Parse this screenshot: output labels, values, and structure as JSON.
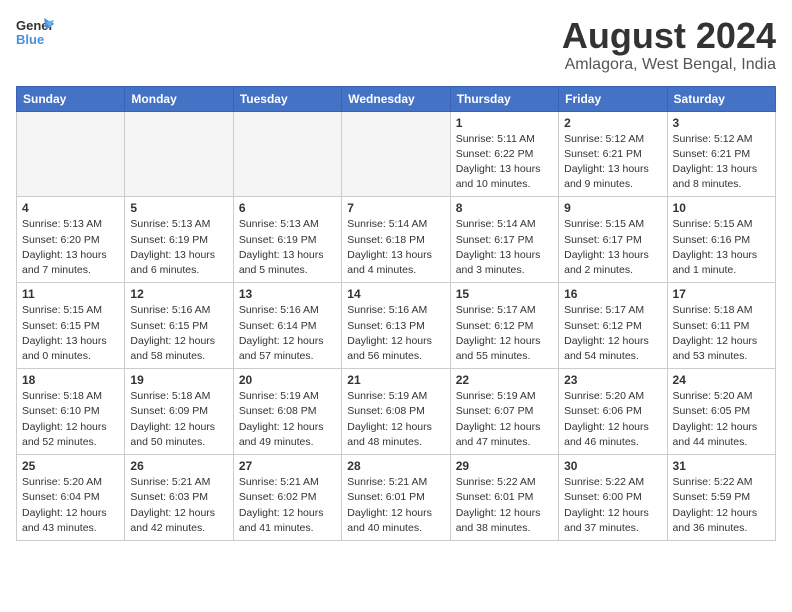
{
  "header": {
    "logo_general": "General",
    "logo_blue": "Blue",
    "month_year": "August 2024",
    "location": "Amlagora, West Bengal, India"
  },
  "days_of_week": [
    "Sunday",
    "Monday",
    "Tuesday",
    "Wednesday",
    "Thursday",
    "Friday",
    "Saturday"
  ],
  "weeks": [
    [
      {
        "day": "",
        "info": ""
      },
      {
        "day": "",
        "info": ""
      },
      {
        "day": "",
        "info": ""
      },
      {
        "day": "",
        "info": ""
      },
      {
        "day": "1",
        "info": "Sunrise: 5:11 AM\nSunset: 6:22 PM\nDaylight: 13 hours\nand 10 minutes."
      },
      {
        "day": "2",
        "info": "Sunrise: 5:12 AM\nSunset: 6:21 PM\nDaylight: 13 hours\nand 9 minutes."
      },
      {
        "day": "3",
        "info": "Sunrise: 5:12 AM\nSunset: 6:21 PM\nDaylight: 13 hours\nand 8 minutes."
      }
    ],
    [
      {
        "day": "4",
        "info": "Sunrise: 5:13 AM\nSunset: 6:20 PM\nDaylight: 13 hours\nand 7 minutes."
      },
      {
        "day": "5",
        "info": "Sunrise: 5:13 AM\nSunset: 6:19 PM\nDaylight: 13 hours\nand 6 minutes."
      },
      {
        "day": "6",
        "info": "Sunrise: 5:13 AM\nSunset: 6:19 PM\nDaylight: 13 hours\nand 5 minutes."
      },
      {
        "day": "7",
        "info": "Sunrise: 5:14 AM\nSunset: 6:18 PM\nDaylight: 13 hours\nand 4 minutes."
      },
      {
        "day": "8",
        "info": "Sunrise: 5:14 AM\nSunset: 6:17 PM\nDaylight: 13 hours\nand 3 minutes."
      },
      {
        "day": "9",
        "info": "Sunrise: 5:15 AM\nSunset: 6:17 PM\nDaylight: 13 hours\nand 2 minutes."
      },
      {
        "day": "10",
        "info": "Sunrise: 5:15 AM\nSunset: 6:16 PM\nDaylight: 13 hours\nand 1 minute."
      }
    ],
    [
      {
        "day": "11",
        "info": "Sunrise: 5:15 AM\nSunset: 6:15 PM\nDaylight: 13 hours\nand 0 minutes."
      },
      {
        "day": "12",
        "info": "Sunrise: 5:16 AM\nSunset: 6:15 PM\nDaylight: 12 hours\nand 58 minutes."
      },
      {
        "day": "13",
        "info": "Sunrise: 5:16 AM\nSunset: 6:14 PM\nDaylight: 12 hours\nand 57 minutes."
      },
      {
        "day": "14",
        "info": "Sunrise: 5:16 AM\nSunset: 6:13 PM\nDaylight: 12 hours\nand 56 minutes."
      },
      {
        "day": "15",
        "info": "Sunrise: 5:17 AM\nSunset: 6:12 PM\nDaylight: 12 hours\nand 55 minutes."
      },
      {
        "day": "16",
        "info": "Sunrise: 5:17 AM\nSunset: 6:12 PM\nDaylight: 12 hours\nand 54 minutes."
      },
      {
        "day": "17",
        "info": "Sunrise: 5:18 AM\nSunset: 6:11 PM\nDaylight: 12 hours\nand 53 minutes."
      }
    ],
    [
      {
        "day": "18",
        "info": "Sunrise: 5:18 AM\nSunset: 6:10 PM\nDaylight: 12 hours\nand 52 minutes."
      },
      {
        "day": "19",
        "info": "Sunrise: 5:18 AM\nSunset: 6:09 PM\nDaylight: 12 hours\nand 50 minutes."
      },
      {
        "day": "20",
        "info": "Sunrise: 5:19 AM\nSunset: 6:08 PM\nDaylight: 12 hours\nand 49 minutes."
      },
      {
        "day": "21",
        "info": "Sunrise: 5:19 AM\nSunset: 6:08 PM\nDaylight: 12 hours\nand 48 minutes."
      },
      {
        "day": "22",
        "info": "Sunrise: 5:19 AM\nSunset: 6:07 PM\nDaylight: 12 hours\nand 47 minutes."
      },
      {
        "day": "23",
        "info": "Sunrise: 5:20 AM\nSunset: 6:06 PM\nDaylight: 12 hours\nand 46 minutes."
      },
      {
        "day": "24",
        "info": "Sunrise: 5:20 AM\nSunset: 6:05 PM\nDaylight: 12 hours\nand 44 minutes."
      }
    ],
    [
      {
        "day": "25",
        "info": "Sunrise: 5:20 AM\nSunset: 6:04 PM\nDaylight: 12 hours\nand 43 minutes."
      },
      {
        "day": "26",
        "info": "Sunrise: 5:21 AM\nSunset: 6:03 PM\nDaylight: 12 hours\nand 42 minutes."
      },
      {
        "day": "27",
        "info": "Sunrise: 5:21 AM\nSunset: 6:02 PM\nDaylight: 12 hours\nand 41 minutes."
      },
      {
        "day": "28",
        "info": "Sunrise: 5:21 AM\nSunset: 6:01 PM\nDaylight: 12 hours\nand 40 minutes."
      },
      {
        "day": "29",
        "info": "Sunrise: 5:22 AM\nSunset: 6:01 PM\nDaylight: 12 hours\nand 38 minutes."
      },
      {
        "day": "30",
        "info": "Sunrise: 5:22 AM\nSunset: 6:00 PM\nDaylight: 12 hours\nand 37 minutes."
      },
      {
        "day": "31",
        "info": "Sunrise: 5:22 AM\nSunset: 5:59 PM\nDaylight: 12 hours\nand 36 minutes."
      }
    ]
  ]
}
